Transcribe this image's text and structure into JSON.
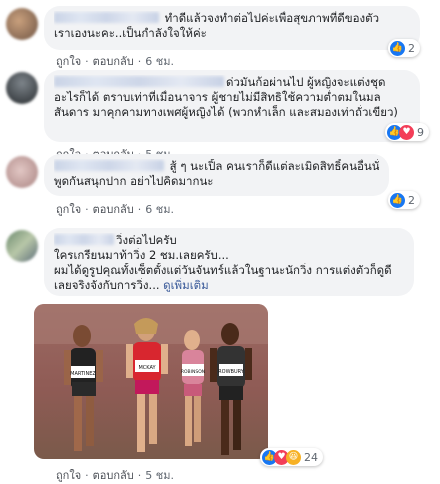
{
  "comments": [
    {
      "lines": [
        "ทำดีแล้วจงทำต่อไปค่ะเพื่อสุขภาพที่ดีของตัว",
        "เราเองนะคะ..เป็นกำลังใจให้ค่ะ"
      ],
      "actions": {
        "like": "ถูกใจ",
        "reply": "ตอบกลับ",
        "time": "6 ชม."
      },
      "reaction_count": "2"
    },
    {
      "lines": [
        "ด่วมันก้อผ่านไป ผู้หญิงจะแต่งชุด",
        "อะไรก็ได้ ตราบเท่าที่เมื่อนาจาร ผู้ชายไม่มีสิทธิใช้ความต่ำตมในมล",
        "สันดาร มาคุกคามทางเพศผู้หญิงได้ (พวกหำเล็ก และสมองเท่าถั่วเขียว)"
      ],
      "actions": {
        "like": "ถูกใจ",
        "reply": "ตอบกลับ",
        "time": "5 ชม."
      },
      "reaction_count": "9"
    },
    {
      "lines": [
        "สู้ ๆ นะเปิ้ล คนเราก็ดีแต่ละเมิดสิทธิ์คนอื่นนั่นล่ะ",
        "พูดกันสนุกปาก อย่าไปคิดมากนะ"
      ],
      "actions": {
        "like": "ถูกใจ",
        "reply": "ตอบกลับ",
        "time": "6 ชม."
      },
      "reaction_count": "2"
    },
    {
      "lines": [
        "วิ่งต่อไปครับ",
        "ใครเกรียนมาท้าวิ่ง 2 ชม.เลยครับ...",
        "ผมได้ดูรูปคุณทั้งเซ็ตตั้งแต่วันจันทร์แล้วในฐานะนักวิ่ง การแต่งตัวก็ดูดี",
        "เลยจริงจังกับการวิ่ง..."
      ],
      "see_more": "ดูเพิ่มเติม",
      "photo_bibs": [
        "MARTINEZ",
        "MCKAY",
        "ROBINSON",
        "ROWBURY"
      ],
      "actions": {
        "like": "ถูกใจ",
        "reply": "ตอบกลับ",
        "time": "5 ชม."
      },
      "reaction_count": "24"
    }
  ],
  "colors": {
    "like": "#1877f2",
    "love": "#f33e58",
    "haha": "#f7b125",
    "link": "#385898",
    "bubble": "#f2f3f5"
  }
}
